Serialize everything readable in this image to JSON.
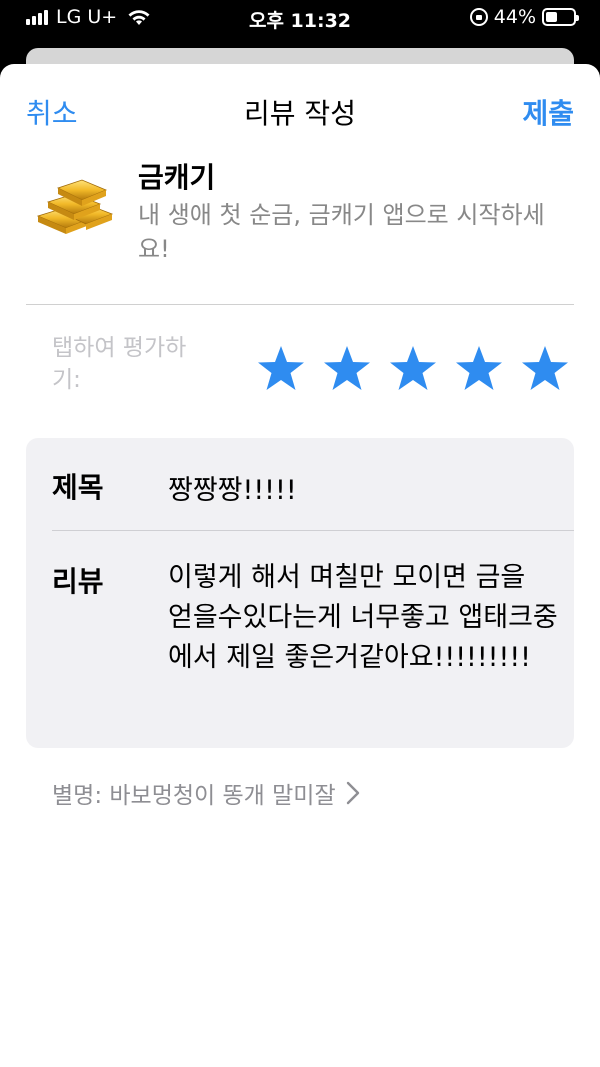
{
  "status_bar": {
    "carrier": "LG U+",
    "time": "오후 11:32",
    "battery": "44%",
    "battery_level": 0.44,
    "signal_bars": 4
  },
  "nav": {
    "cancel": "취소",
    "title": "리뷰 작성",
    "submit": "제출"
  },
  "app": {
    "name": "금캐기",
    "subtitle": "내 생애 첫 순금, 금캐기 앱으로 시작하세요!",
    "icon": "gold-bars-icon"
  },
  "rating": {
    "label": "탭하여 평가하기:",
    "stars_filled": 5,
    "stars_total": 5,
    "star_color": "#2f8cf0"
  },
  "form": {
    "title_label": "제목",
    "title_value": "짱짱짱!!!!!",
    "review_label": "리뷰",
    "review_value": "이렇게 해서 며칠만 모이면 금을 얻을수있다는게 너무좋고 앱태크중에서 제일 좋은거같아요!!!!!!!!!"
  },
  "nickname": {
    "text": "별명: 바보멍청이 똥개 말미잘"
  },
  "colors": {
    "accent": "#2f8cf0",
    "secondary_text": "#8e8e93",
    "form_bg": "#f1f1f4"
  }
}
